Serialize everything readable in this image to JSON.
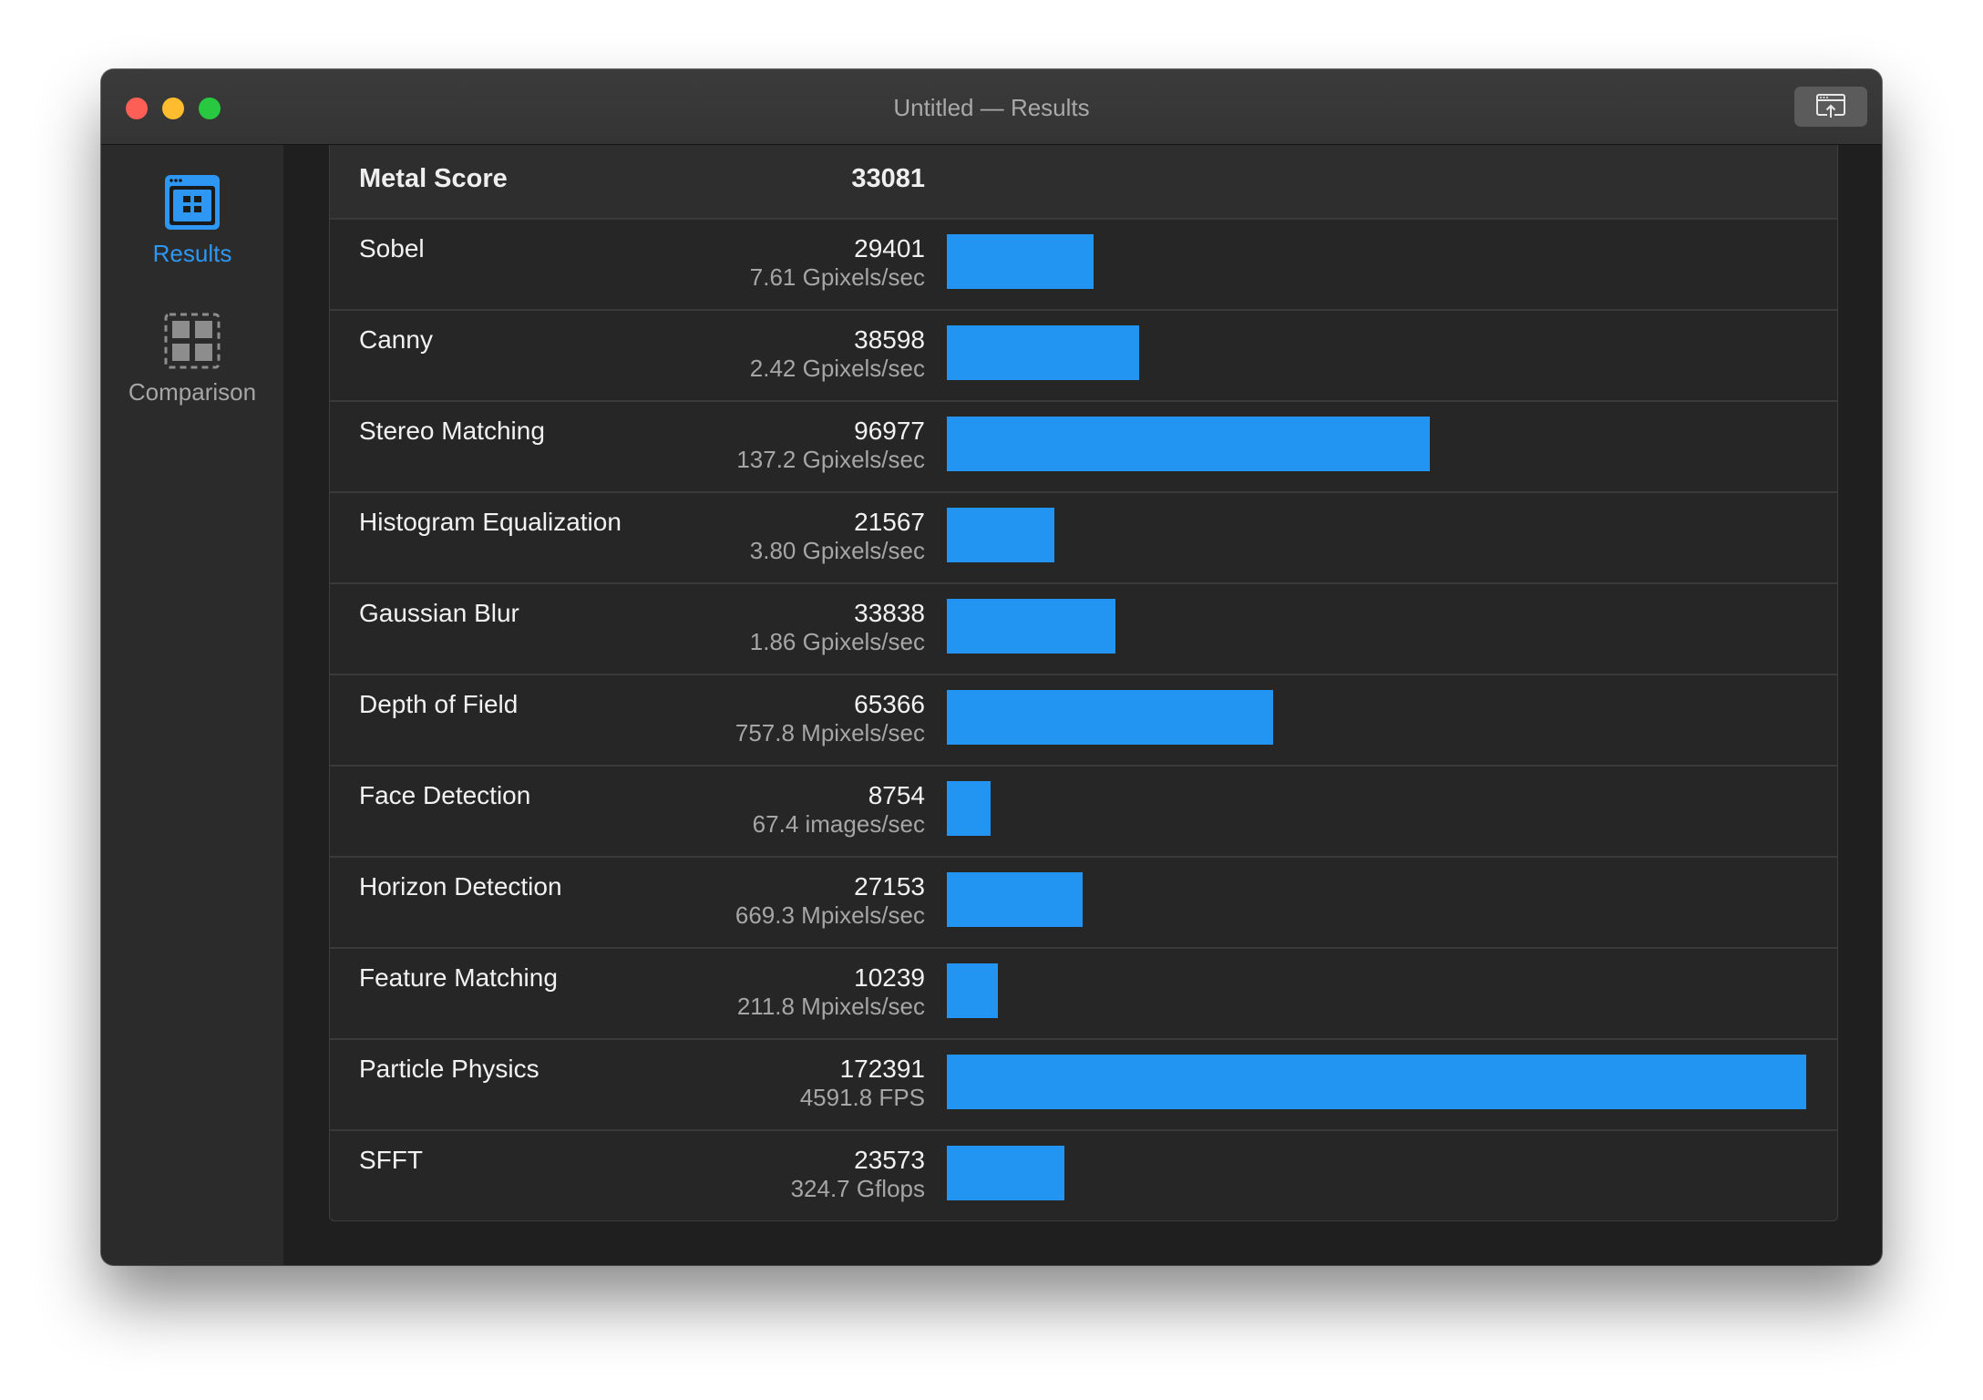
{
  "window": {
    "title": "Untitled — Results"
  },
  "colors": {
    "accent": "#2294f2",
    "close": "#fd5f57",
    "minimize": "#febc2e",
    "maximize": "#28c840"
  },
  "toolbar": {
    "share_icon": "share-icon"
  },
  "sidebar": {
    "items": [
      {
        "label": "Results",
        "icon": "results-icon",
        "selected": true
      },
      {
        "label": "Comparison",
        "icon": "comparison-icon",
        "selected": false
      }
    ]
  },
  "metal_score": {
    "label": "Metal Score",
    "value": "33081"
  },
  "tests": [
    {
      "name": "Sobel",
      "score": "29401",
      "rate": "7.61 Gpixels/sec"
    },
    {
      "name": "Canny",
      "score": "38598",
      "rate": "2.42 Gpixels/sec"
    },
    {
      "name": "Stereo Matching",
      "score": "96977",
      "rate": "137.2 Gpixels/sec"
    },
    {
      "name": "Histogram Equalization",
      "score": "21567",
      "rate": "3.80 Gpixels/sec"
    },
    {
      "name": "Gaussian Blur",
      "score": "33838",
      "rate": "1.86 Gpixels/sec"
    },
    {
      "name": "Depth of Field",
      "score": "65366",
      "rate": "757.8 Mpixels/sec"
    },
    {
      "name": "Face Detection",
      "score": "8754",
      "rate": "67.4 images/sec"
    },
    {
      "name": "Horizon Detection",
      "score": "27153",
      "rate": "669.3 Mpixels/sec"
    },
    {
      "name": "Feature Matching",
      "score": "10239",
      "rate": "211.8 Mpixels/sec"
    },
    {
      "name": "Particle Physics",
      "score": "172391",
      "rate": "4591.8 FPS"
    },
    {
      "name": "SFFT",
      "score": "23573",
      "rate": "324.7 Gflops"
    }
  ]
}
